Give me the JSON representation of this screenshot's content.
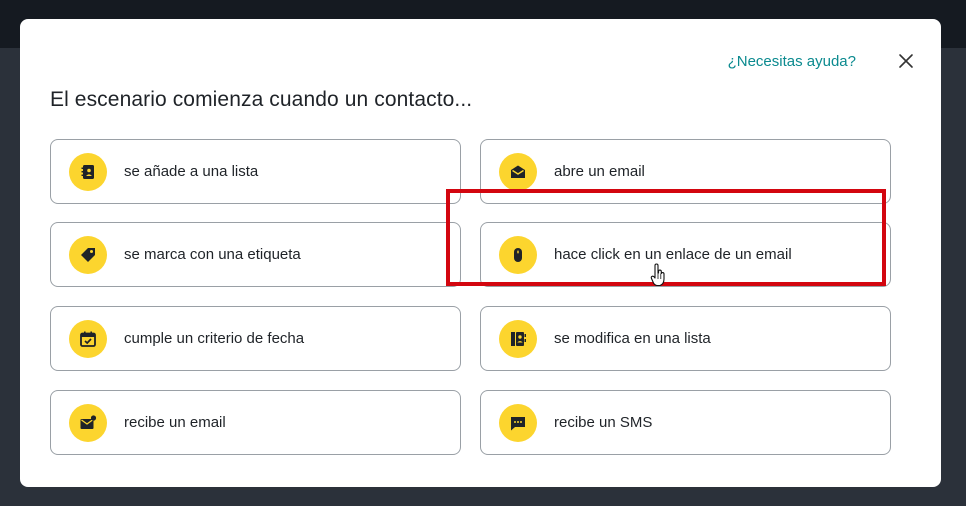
{
  "help_link": "¿Necesitas ayuda?",
  "title": "El escenario comienza cuando un contacto...",
  "options": [
    {
      "label": "se añade a una lista",
      "icon": "contact-book-icon"
    },
    {
      "label": "abre un email",
      "icon": "open-envelope-icon"
    },
    {
      "label": "se marca con una etiqueta",
      "icon": "tag-icon"
    },
    {
      "label": "hace click en un enlace de un email",
      "icon": "mouse-icon"
    },
    {
      "label": "cumple un criterio de fecha",
      "icon": "calendar-check-icon"
    },
    {
      "label": "se modifica en una lista",
      "icon": "contact-list-edit-icon"
    },
    {
      "label": "recibe un email",
      "icon": "envelope-notification-icon"
    },
    {
      "label": "recibe un SMS",
      "icon": "sms-icon"
    }
  ],
  "colors": {
    "accent": "#fcd52e",
    "link": "#0b8a8f",
    "highlight": "#d3060f"
  }
}
